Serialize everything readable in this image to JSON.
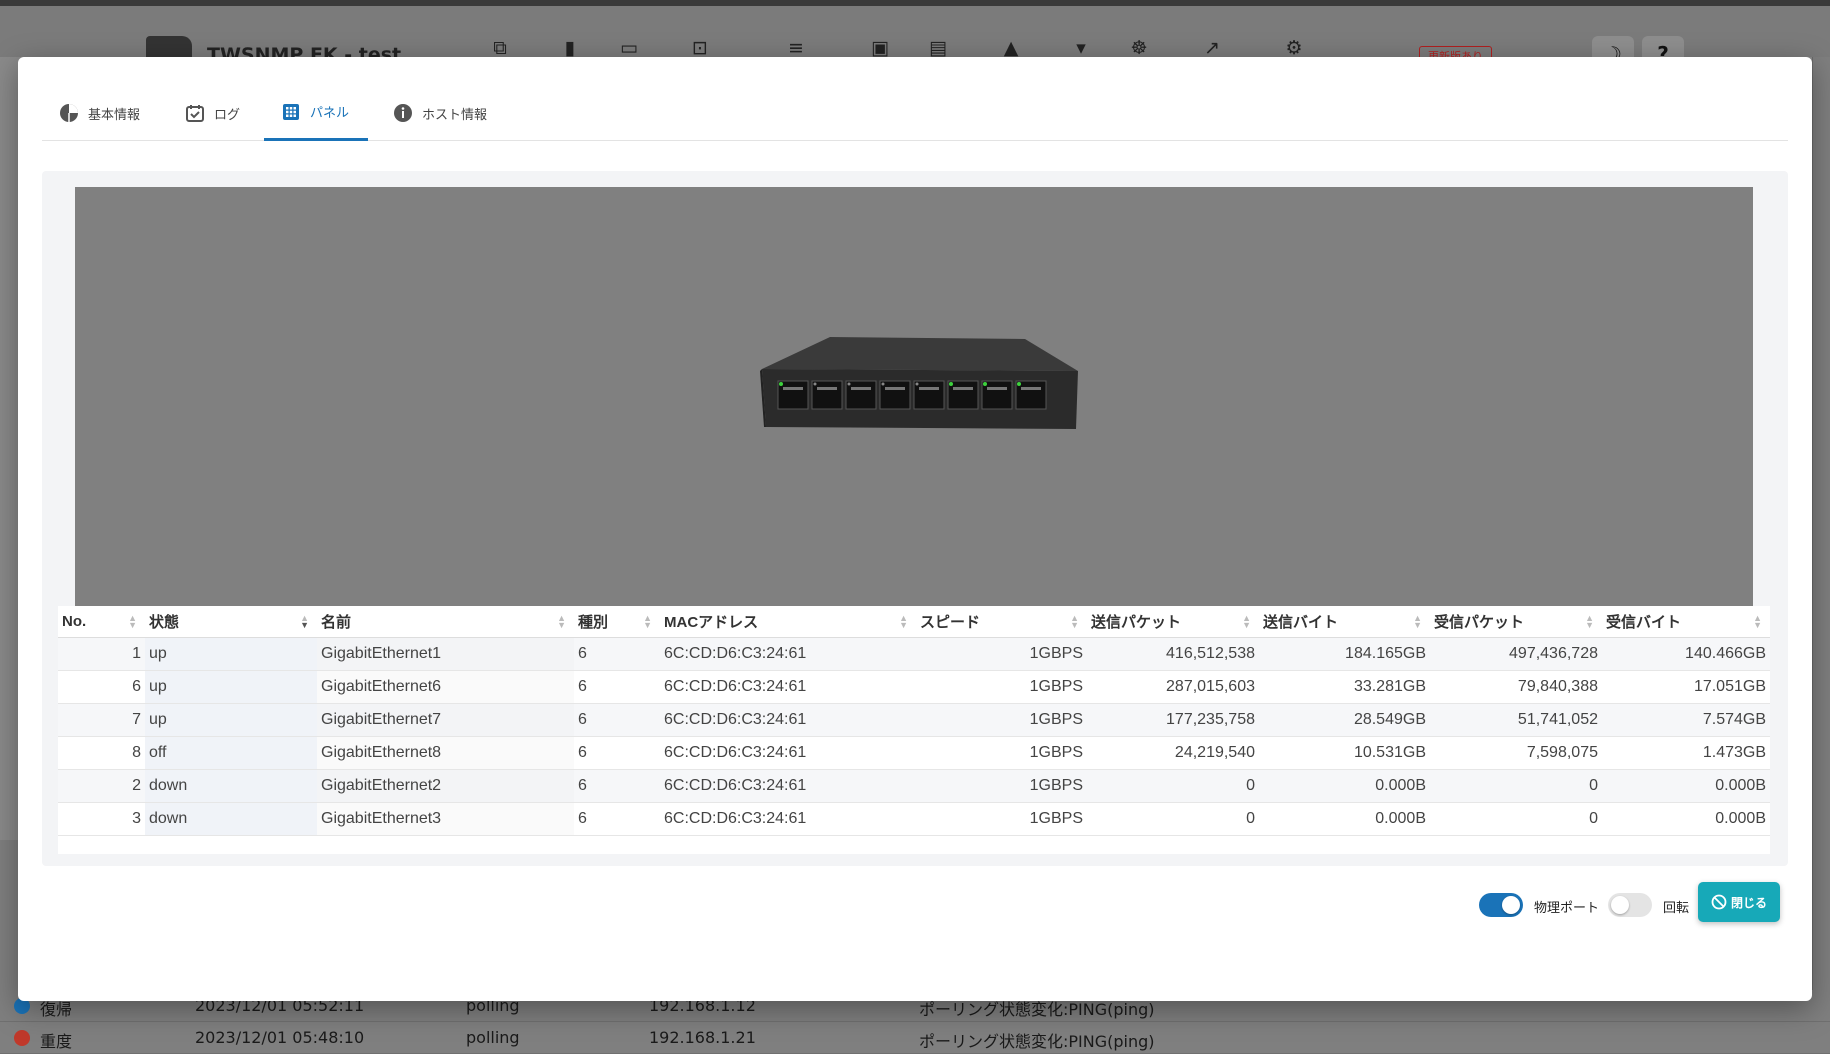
{
  "app": {
    "title": "TWSNMP FK - test",
    "update_badge": "更新版あり",
    "theme_button": "☽",
    "help_button": "?"
  },
  "nav_icons": [
    "network-map-icon",
    "map-icon",
    "device-list-icon",
    "polling-icon",
    "check-list-icon",
    "calendar-check-icon",
    "calendar-icon",
    "alert-icon",
    "report-icon",
    "ai-icon",
    "chart-icon",
    "gear-icon"
  ],
  "tabs": [
    {
      "label": "基本情報",
      "icon": "pie-chart-icon"
    },
    {
      "label": "ログ",
      "icon": "calendar-check-icon"
    },
    {
      "label": "パネル",
      "icon": "grid-icon"
    },
    {
      "label": "ホスト情報",
      "icon": "info-icon"
    }
  ],
  "table": {
    "headers": [
      "No.",
      "状態",
      "名前",
      "種別",
      "MACアドレス",
      "スピード",
      "送信パケット",
      "送信バイト",
      "受信パケット",
      "受信バイト"
    ],
    "rows": [
      {
        "no": "1",
        "state": "up",
        "name": "GigabitEthernet1",
        "type": "6",
        "mac": "6C:CD:D6:C3:24:61",
        "speed": "1GBPS",
        "tx_packets": "416,512,538",
        "tx_bytes": "184.165GB",
        "rx_packets": "497,436,728",
        "rx_bytes": "140.466GB"
      },
      {
        "no": "6",
        "state": "up",
        "name": "GigabitEthernet6",
        "type": "6",
        "mac": "6C:CD:D6:C3:24:61",
        "speed": "1GBPS",
        "tx_packets": "287,015,603",
        "tx_bytes": "33.281GB",
        "rx_packets": "79,840,388",
        "rx_bytes": "17.051GB"
      },
      {
        "no": "7",
        "state": "up",
        "name": "GigabitEthernet7",
        "type": "6",
        "mac": "6C:CD:D6:C3:24:61",
        "speed": "1GBPS",
        "tx_packets": "177,235,758",
        "tx_bytes": "28.549GB",
        "rx_packets": "51,741,052",
        "rx_bytes": "7.574GB"
      },
      {
        "no": "8",
        "state": "off",
        "name": "GigabitEthernet8",
        "type": "6",
        "mac": "6C:CD:D6:C3:24:61",
        "speed": "1GBPS",
        "tx_packets": "24,219,540",
        "tx_bytes": "10.531GB",
        "rx_packets": "7,598,075",
        "rx_bytes": "1.473GB"
      },
      {
        "no": "2",
        "state": "down",
        "name": "GigabitEthernet2",
        "type": "6",
        "mac": "6C:CD:D6:C3:24:61",
        "speed": "1GBPS",
        "tx_packets": "0",
        "tx_bytes": "0.000B",
        "rx_packets": "0",
        "rx_bytes": "0.000B"
      },
      {
        "no": "3",
        "state": "down",
        "name": "GigabitEthernet3",
        "type": "6",
        "mac": "6C:CD:D6:C3:24:61",
        "speed": "1GBPS",
        "tx_packets": "0",
        "tx_bytes": "0.000B",
        "rx_packets": "0",
        "rx_bytes": "0.000B"
      }
    ]
  },
  "footer": {
    "physical_port_label": "物理ポート",
    "physical_port_on": true,
    "rotate_label": "回転",
    "rotate_on": false,
    "close_label": "閉じる"
  },
  "colors": {
    "accent": "#1a73b8",
    "toggle_on": "#1a73b8",
    "close_button": "#17a9b8",
    "viewer_bg": "#808080"
  },
  "background_log": [
    {
      "level": "復帰",
      "time": "2023/12/01 05:52:11",
      "type": "polling",
      "ip": "192.168.1.12",
      "message": "ポーリング状態変化:PING(ping)",
      "color": "#1a73b8"
    },
    {
      "level": "重度",
      "time": "2023/12/01 05:48:10",
      "type": "polling",
      "ip": "192.168.1.21",
      "message": "ポーリング状態変化:PING(ping)",
      "color": "#c0392b"
    }
  ]
}
